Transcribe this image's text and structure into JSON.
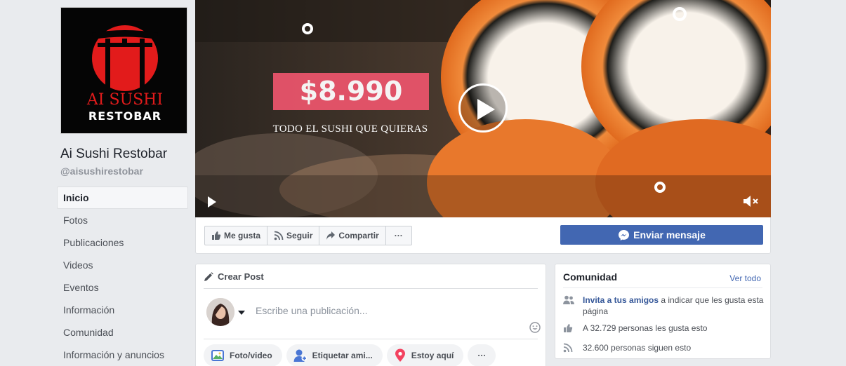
{
  "page": {
    "name": "Ai Sushi Restobar",
    "handle": "@aisushirestobar",
    "logo_text": [
      "AI SUSHI",
      "RESTOBAR"
    ]
  },
  "nav": {
    "items": [
      {
        "label": "Inicio",
        "active": true
      },
      {
        "label": "Fotos"
      },
      {
        "label": "Publicaciones"
      },
      {
        "label": "Videos"
      },
      {
        "label": "Eventos"
      },
      {
        "label": "Información"
      },
      {
        "label": "Comunidad"
      },
      {
        "label": "Información y anuncios"
      }
    ]
  },
  "cover": {
    "price": "$8.990",
    "promo": "TODO EL SUSHI QUE QUIERAS",
    "icons": {
      "play": "play-icon",
      "mute": "mute-icon"
    }
  },
  "actions": {
    "like": "Me gusta",
    "follow": "Seguir",
    "share": "Compartir",
    "more": "···",
    "message": "Enviar mensaje"
  },
  "create_post": {
    "title": "Crear Post",
    "placeholder": "Escribe una publicación...",
    "chips": [
      {
        "label": "Foto/video",
        "icon": "photo-icon"
      },
      {
        "label": "Etiquetar ami...",
        "icon": "tag-friends-icon"
      },
      {
        "label": "Estoy aquí",
        "icon": "location-pin-icon"
      },
      {
        "label": "···",
        "icon": "more-icon"
      }
    ]
  },
  "community": {
    "title": "Comunidad",
    "see_all": "Ver todo",
    "invite_link": "Invita a tus amigos",
    "invite_rest": " a indicar que les gusta esta página",
    "likes": "A 32.729 personas les gusta esto",
    "follows": "32.600 personas siguen esto"
  },
  "colors": {
    "brand_blue": "#4267b2",
    "link_blue": "#365899",
    "price_pink": "#e9546b",
    "logo_red": "#e21b1b",
    "background": "#e9ebee"
  }
}
